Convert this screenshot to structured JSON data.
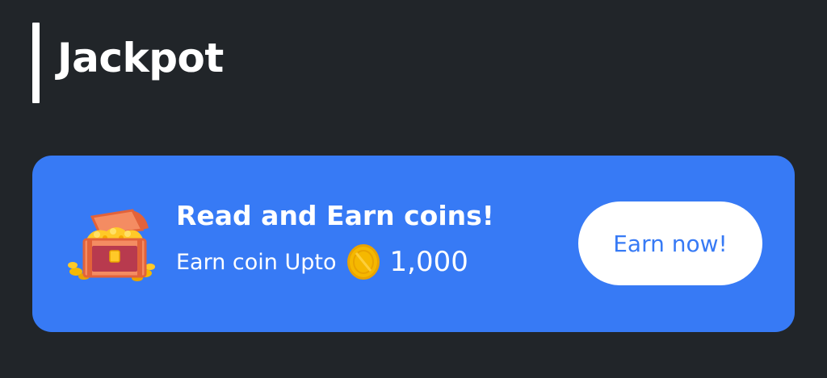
{
  "section": {
    "title": "Jackpot"
  },
  "promo": {
    "title": "Read and Earn coins!",
    "subtitle_label": "Earn coin Upto",
    "coin_amount": "1,000",
    "button_label": "Earn now!",
    "icons": {
      "chest": "treasure-chest-icon",
      "coin": "gold-coin-icon"
    }
  },
  "colors": {
    "background": "#212529",
    "card": "#377af5",
    "button_bg": "#ffffff",
    "button_text": "#377af5",
    "text": "#ffffff",
    "coin": "#f5b800"
  }
}
